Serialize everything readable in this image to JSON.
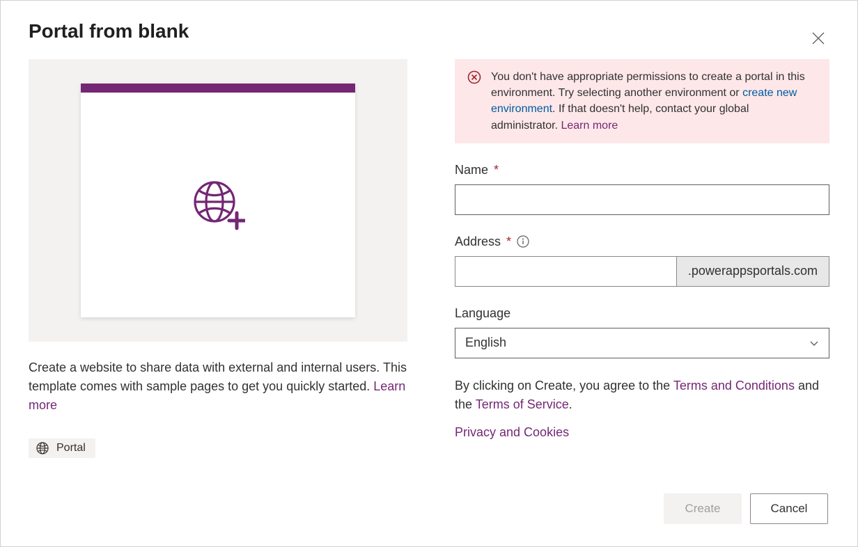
{
  "dialog": {
    "title": "Portal from blank"
  },
  "preview": {
    "description_prefix": "Create a website to share data with external and internal users. This template comes with sample pages to get you quickly started. ",
    "learn_more_label": "Learn more",
    "badge_label": "Portal"
  },
  "error": {
    "text_before_env_link": "You don't have appropriate permissions to create a portal in this environment. Try selecting another environment or ",
    "create_env_link": "create new environment",
    "text_after_env_link": ". If that doesn't help, contact your global administrator. ",
    "learn_more_label": "Learn more"
  },
  "form": {
    "name_label": "Name",
    "name_value": "",
    "address_label": "Address",
    "address_value": "",
    "address_suffix": ".powerappsportals.com",
    "language_label": "Language",
    "language_value": "English"
  },
  "agreement": {
    "prefix": "By clicking on Create, you agree to the ",
    "terms_conditions_label": "Terms and Conditions",
    "middle": " and the ",
    "terms_service_label": "Terms of Service",
    "suffix": ".",
    "privacy_label": "Privacy and Cookies"
  },
  "footer": {
    "create_label": "Create",
    "cancel_label": "Cancel"
  }
}
